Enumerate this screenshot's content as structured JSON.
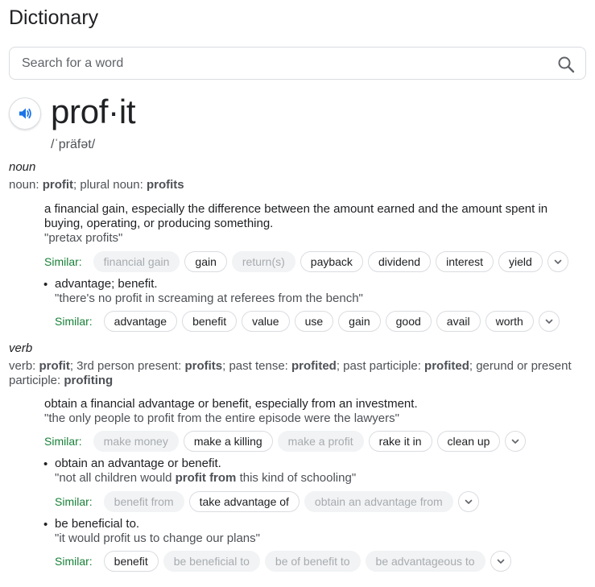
{
  "title": "Dictionary",
  "search": {
    "placeholder": "Search for a word"
  },
  "entry": {
    "word": "prof·it",
    "phonetic": "/ˈpräfət/"
  },
  "noun": {
    "pos": "noun",
    "forms": [
      {
        "text": "noun: ",
        "bold": false
      },
      {
        "text": "profit",
        "bold": true
      },
      {
        "text": "; plural noun: ",
        "bold": false
      },
      {
        "text": "profits",
        "bold": true
      }
    ],
    "senses": [
      {
        "definition": "a financial gain, especially the difference between the amount earned and the amount spent in buying, operating, or producing something.",
        "example": [
          {
            "text": "\"pretax profits\"",
            "bold": false
          }
        ],
        "similar": [
          {
            "label": "financial gain",
            "dim": true
          },
          {
            "label": "gain",
            "dim": false
          },
          {
            "label": "return(s)",
            "dim": true
          },
          {
            "label": "payback",
            "dim": false
          },
          {
            "label": "dividend",
            "dim": false
          },
          {
            "label": "interest",
            "dim": false
          },
          {
            "label": "yield",
            "dim": false
          }
        ]
      },
      {
        "definition": "advantage; benefit.",
        "example": [
          {
            "text": "\"there's no profit in screaming at referees from the bench\"",
            "bold": false
          }
        ],
        "similar": [
          {
            "label": "advantage",
            "dim": false
          },
          {
            "label": "benefit",
            "dim": false
          },
          {
            "label": "value",
            "dim": false
          },
          {
            "label": "use",
            "dim": false
          },
          {
            "label": "gain",
            "dim": false
          },
          {
            "label": "good",
            "dim": false
          },
          {
            "label": "avail",
            "dim": false
          },
          {
            "label": "worth",
            "dim": false
          }
        ]
      }
    ]
  },
  "verb": {
    "pos": "verb",
    "forms": [
      {
        "text": "verb: ",
        "bold": false
      },
      {
        "text": "profit",
        "bold": true
      },
      {
        "text": "; 3rd person present: ",
        "bold": false
      },
      {
        "text": "profits",
        "bold": true
      },
      {
        "text": "; past tense: ",
        "bold": false
      },
      {
        "text": "profited",
        "bold": true
      },
      {
        "text": "; past participle: ",
        "bold": false
      },
      {
        "text": "profited",
        "bold": true
      },
      {
        "text": "; gerund or present participle: ",
        "bold": false
      },
      {
        "text": "profiting",
        "bold": true
      }
    ],
    "senses": [
      {
        "definition": "obtain a financial advantage or benefit, especially from an investment.",
        "example": [
          {
            "text": "\"the only people to profit from the entire episode were the lawyers\"",
            "bold": false
          }
        ],
        "similar": [
          {
            "label": "make money",
            "dim": true
          },
          {
            "label": "make a killing",
            "dim": false
          },
          {
            "label": "make a profit",
            "dim": true
          },
          {
            "label": "rake it in",
            "dim": false
          },
          {
            "label": "clean up",
            "dim": false
          }
        ]
      },
      {
        "definition": "obtain an advantage or benefit.",
        "example": [
          {
            "text": "\"not all children would ",
            "bold": false
          },
          {
            "text": "profit from",
            "bold": true
          },
          {
            "text": " this kind of schooling\"",
            "bold": false
          }
        ],
        "similar": [
          {
            "label": "benefit from",
            "dim": true
          },
          {
            "label": "take advantage of",
            "dim": false
          },
          {
            "label": "obtain an advantage from",
            "dim": true
          }
        ]
      },
      {
        "definition": "be beneficial to.",
        "example": [
          {
            "text": "\"it would profit us to change our plans\"",
            "bold": false
          }
        ],
        "similar": [
          {
            "label": "benefit",
            "dim": false
          },
          {
            "label": "be beneficial to",
            "dim": true
          },
          {
            "label": "be of benefit to",
            "dim": true
          },
          {
            "label": "be advantageous to",
            "dim": true
          }
        ]
      }
    ]
  },
  "similar_label": "Similar:",
  "bullet_char": "•"
}
